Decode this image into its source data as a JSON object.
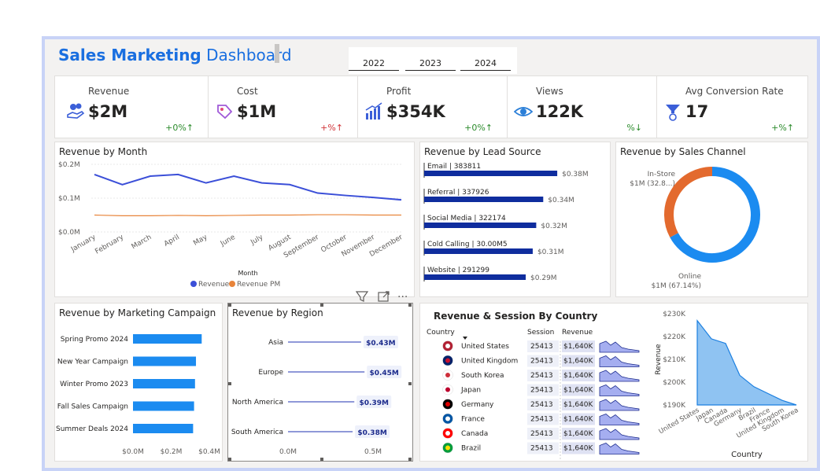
{
  "header": {
    "title_bold": "Sales Marketing",
    "title_rest": "Dashboard",
    "years": [
      "2022",
      "2023",
      "2024"
    ]
  },
  "kpis": [
    {
      "label": "Revenue",
      "value": "$2M",
      "delta": "+0%↑",
      "delta_color": "green",
      "icon": "money-hand-icon"
    },
    {
      "label": "Cost",
      "value": "$1M",
      "delta": "+%↑",
      "delta_color": "red",
      "icon": "tag-icon"
    },
    {
      "label": "Profit",
      "value": "$354K",
      "delta": "+0%↑",
      "delta_color": "green",
      "icon": "growth-chart-icon"
    },
    {
      "label": "Views",
      "value": "122K",
      "delta": "%↓",
      "delta_color": "green",
      "icon": "eye-icon"
    },
    {
      "label": "Avg Conversion Rate",
      "value": "17",
      "delta": "+%↑",
      "delta_color": "green",
      "icon": "funnel-coin-icon"
    }
  ],
  "colors": {
    "accent": "#1a6fe0",
    "revenue_line": "#3b4fd8",
    "revenue_pm": "#e8843a",
    "lead_bar": "#0f2d9e",
    "campaign_bar": "#1b8bf0",
    "donut_online": "#1b8bf0",
    "donut_instore": "#e36a2e",
    "area_fill": "#8fc3f2"
  },
  "chart_data": [
    {
      "id": "revenue_by_month",
      "type": "line",
      "title": "Revenue by Month",
      "xlabel": "Month",
      "ylabel": "",
      "categories": [
        "January",
        "February",
        "March",
        "April",
        "May",
        "June",
        "July",
        "August",
        "September",
        "October",
        "November",
        "December"
      ],
      "y_ticks": [
        "$0.0M",
        "$0.1M",
        "$0.2M"
      ],
      "ylim": [
        0,
        0.2
      ],
      "series": [
        {
          "name": "Revenue",
          "values": [
            0.17,
            0.14,
            0.165,
            0.17,
            0.145,
            0.165,
            0.145,
            0.14,
            0.115,
            0.108,
            0.102,
            0.095
          ]
        },
        {
          "name": "Revenue PM",
          "values": [
            0.05,
            0.048,
            0.048,
            0.049,
            0.048,
            0.049,
            0.05,
            0.05,
            0.051,
            0.051,
            0.05,
            0.05
          ]
        }
      ],
      "legend_placement": "bottom"
    },
    {
      "id": "revenue_by_lead_source",
      "type": "bar",
      "title": "Revenue by Lead Source",
      "categories": [
        "Email | 383811",
        "Referral | 337926",
        "Social Media | 322174",
        "Cold Calling | 30.00M5",
        "Website | 291299"
      ],
      "values": [
        0.38,
        0.34,
        0.32,
        0.31,
        0.29
      ],
      "value_labels": [
        "$0.38M",
        "$0.34M",
        "$0.32M",
        "$0.31M",
        "$0.29M"
      ]
    },
    {
      "id": "revenue_by_sales_channel",
      "type": "pie",
      "title": "Revenue by Sales Channel",
      "categories": [
        "Online",
        "In-Store"
      ],
      "values": [
        67.14,
        32.86
      ],
      "labels": [
        "In-Store",
        "$1M (32.8...)",
        "Online",
        "$1M (67.14%)"
      ]
    },
    {
      "id": "revenue_by_marketing_campaign",
      "type": "bar",
      "title": "Revenue by Marketing Campaign",
      "categories": [
        "Spring Promo 2024",
        "New Year Campaign",
        "Winter Promo 2023",
        "Fall Sales Campaign",
        "Summer Deals 2024"
      ],
      "values": [
        0.36,
        0.33,
        0.325,
        0.32,
        0.315
      ],
      "x_ticks": [
        "$0.0M",
        "$0.2M",
        "$0.4M"
      ],
      "xlim": [
        0,
        0.4
      ]
    },
    {
      "id": "revenue_by_region",
      "type": "bar",
      "title": "Revenue by Region",
      "categories": [
        "Asia",
        "Europe",
        "North America",
        "South America"
      ],
      "values": [
        0.43,
        0.45,
        0.39,
        0.38
      ],
      "value_labels": [
        "$0.43M",
        "$0.45M",
        "$0.39M",
        "$0.38M"
      ],
      "x_ticks": [
        "0.0M",
        "0.5M"
      ],
      "xlim": [
        0,
        0.5
      ]
    },
    {
      "id": "revenue_by_country",
      "type": "area",
      "title": "Revenue & Session By Country",
      "xlabel": "Country",
      "ylabel": "Revenue",
      "categories": [
        "United States",
        "Japan",
        "Canada",
        "Germany",
        "Brazil",
        "France",
        "United Kingdom",
        "South Korea"
      ],
      "values": [
        227,
        219,
        217,
        203,
        198,
        195,
        192,
        190
      ],
      "y_ticks": [
        "$190K",
        "$200K",
        "$210K",
        "$220K",
        "$230K"
      ],
      "ylim": [
        190,
        230
      ]
    }
  ],
  "country_table": {
    "headers": [
      "Country",
      "Session",
      "Revenue"
    ],
    "rows": [
      {
        "country": "United States",
        "flag": "us-flag-icon",
        "session": "25413",
        "revenue": "$1,640K"
      },
      {
        "country": "United Kingdom",
        "flag": "uk-flag-icon",
        "session": "25413",
        "revenue": "$1,640K"
      },
      {
        "country": "South Korea",
        "flag": "kr-flag-icon",
        "session": "25413",
        "revenue": "$1,640K"
      },
      {
        "country": "Japan",
        "flag": "jp-flag-icon",
        "session": "25413",
        "revenue": "$1,640K"
      },
      {
        "country": "Germany",
        "flag": "de-flag-icon",
        "session": "25413",
        "revenue": "$1,640K"
      },
      {
        "country": "France",
        "flag": "fr-flag-icon",
        "session": "25413",
        "revenue": "$1,640K"
      },
      {
        "country": "Canada",
        "flag": "ca-flag-icon",
        "session": "25413",
        "revenue": "$1,640K"
      },
      {
        "country": "Brazil",
        "flag": "br-flag-icon",
        "session": "25413",
        "revenue": "$1,640K"
      }
    ]
  },
  "visual_toolbar": {
    "filter_icon": "filter-icon",
    "focus_icon": "focus-mode-icon",
    "more_icon": "more-options-icon",
    "more_label": "···"
  }
}
